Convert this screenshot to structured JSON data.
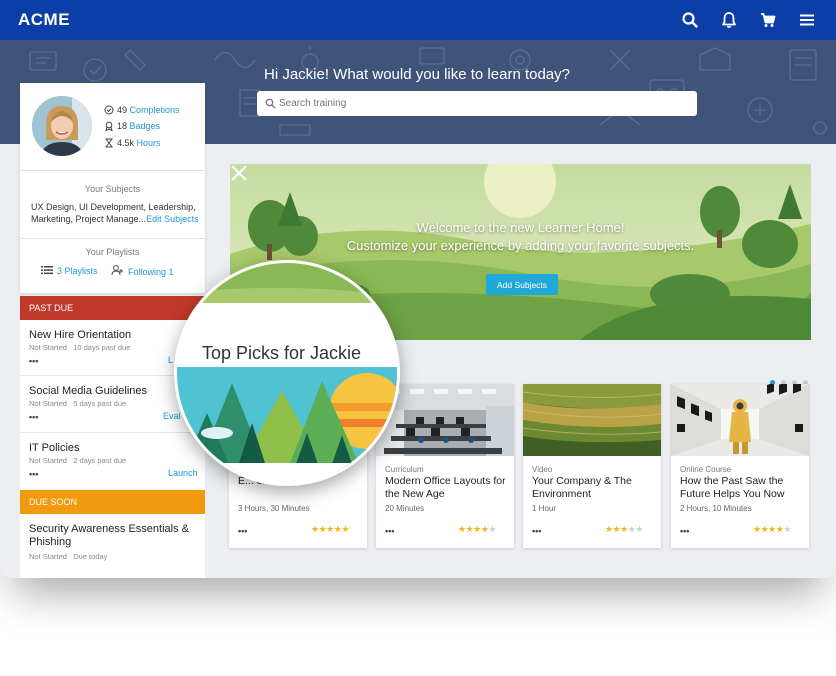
{
  "header": {
    "logo": "ACME",
    "icons": [
      "search-icon",
      "bell-icon",
      "cart-icon",
      "menu-icon"
    ],
    "color": "#0c3ea7"
  },
  "hero": {
    "greeting": "Hi Jackie! What would you like to learn today?",
    "search_placeholder": "Search training"
  },
  "profile": {
    "completions_count": "49",
    "completions_label": "Completions",
    "badges_count": "18",
    "badges_label": "Badges",
    "hours_count": "4.5k",
    "hours_label": "Hours",
    "subjects_title": "Your Subjects",
    "subjects_text": "UX Design, UI Development, Leadership, Marketing, Project Manage...",
    "edit_subjects": "Edit Subjects",
    "playlists_title": "Your Playlists",
    "playlists_link": "3 Playlists",
    "following_link": "Following 1"
  },
  "tasks": {
    "past_due_label": "PAST DUE",
    "past_due_color": "#c0392b",
    "due_soon_label": "DUE SOON",
    "due_soon_color": "#f29a0e",
    "items": [
      {
        "title": "New Hire Orientation",
        "status": "Not Started",
        "due": "10 days past due",
        "action": "L"
      },
      {
        "title": "Social Media Guidelines",
        "status": "Not Started",
        "due": "5 days past due",
        "action": "Eval"
      },
      {
        "title": "IT Policies",
        "status": "Not Started",
        "due": "2 days past due",
        "action": "Launch"
      }
    ],
    "soon": [
      {
        "title": "Security Awareness Essentials & Phishing",
        "status": "Not Started",
        "due": "Due today"
      }
    ],
    "dots": "•••"
  },
  "banner": {
    "line1": "Welcome to the new Learner Home!",
    "line2": "Customize your experience by adding your favorite subjects.",
    "button": "Add Subjects"
  },
  "carousel": {
    "count": 4,
    "active": 0
  },
  "magnifier": {
    "title": "Top Picks for Jackie"
  },
  "cards": [
    {
      "type": "",
      "title": "E... ok Inward",
      "duration": "3 Hours, 30 Minutes",
      "rating": 4.5,
      "image": "triangles"
    },
    {
      "type": "Curriculum",
      "title": "Modern Office Layouts for the New Age",
      "duration": "20 Minutes",
      "rating": 3.5,
      "image": "office"
    },
    {
      "type": "Video",
      "title": "Your Company & The Environment",
      "duration": "1 Hour",
      "rating": 2.5,
      "image": "fields"
    },
    {
      "type": "Online Course",
      "title": "How the Past Saw the Future Helps You Now",
      "duration": "2 Hours, 10 Minutes",
      "rating": 3.5,
      "image": "space"
    }
  ]
}
